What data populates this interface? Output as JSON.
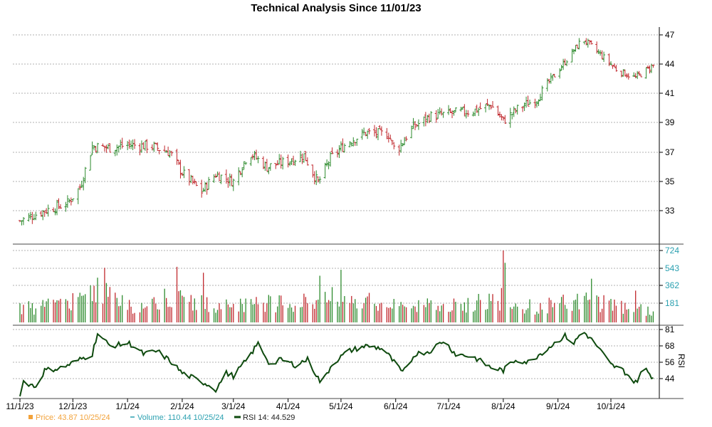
{
  "chart_data": {
    "type": "ohlc",
    "title": "Technical Analysis Since 11/01/23",
    "x_ticks": [
      "11/1/23",
      "12/1/23",
      "1/1/24",
      "2/1/24",
      "3/1/24",
      "4/1/24",
      "5/1/24",
      "6/1/24",
      "7/1/24",
      "8/1/24",
      "9/1/24",
      "10/1/24"
    ],
    "price_axis": {
      "ticks": [
        "33",
        "35",
        "37",
        "39",
        "41",
        "44",
        "47"
      ],
      "ylim": [
        31.5,
        47.6
      ]
    },
    "volume_axis": {
      "ticks": [
        "181",
        "362",
        "543",
        "724"
      ],
      "ylim": [
        0,
        724
      ]
    },
    "rsi_axis": {
      "label": "RSI",
      "ticks": [
        "44",
        "56",
        "68",
        "81"
      ],
      "ylim": [
        30,
        81
      ]
    },
    "colors": {
      "up": "#2e8b2e",
      "down": "#c0282d",
      "rsi": "#0e4a0e",
      "volume_label": "#2aa0b0",
      "price_label": "#f2a23a",
      "grid": "#b0b0b0"
    },
    "price_anchors": [
      {
        "date": "11/1/23",
        "close": 32.3
      },
      {
        "date": "11/15/23",
        "close": 33.0
      },
      {
        "date": "11/28/23",
        "close": 33.5
      },
      {
        "date": "12/5/23",
        "close": 34.6
      },
      {
        "date": "12/12/23",
        "close": 37.4
      },
      {
        "date": "12/22/23",
        "close": 37.3
      },
      {
        "date": "1/2/24",
        "close": 37.5
      },
      {
        "date": "1/15/24",
        "close": 37.4
      },
      {
        "date": "1/25/24",
        "close": 37.0
      },
      {
        "date": "2/1/24",
        "close": 35.6
      },
      {
        "date": "2/12/24",
        "close": 34.3
      },
      {
        "date": "2/20/24",
        "close": 35.5
      },
      {
        "date": "3/1/24",
        "close": 35.0
      },
      {
        "date": "3/10/24",
        "close": 37.0
      },
      {
        "date": "3/20/24",
        "close": 36.0
      },
      {
        "date": "4/1/24",
        "close": 36.4
      },
      {
        "date": "4/10/24",
        "close": 36.8
      },
      {
        "date": "4/18/24",
        "close": 34.9
      },
      {
        "date": "4/25/24",
        "close": 36.6
      },
      {
        "date": "5/5/24",
        "close": 37.7
      },
      {
        "date": "5/15/24",
        "close": 38.3
      },
      {
        "date": "5/28/24",
        "close": 38.2
      },
      {
        "date": "6/1/24",
        "close": 37.0
      },
      {
        "date": "6/10/24",
        "close": 38.6
      },
      {
        "date": "6/20/24",
        "close": 39.4
      },
      {
        "date": "7/1/24",
        "close": 39.6
      },
      {
        "date": "7/15/24",
        "close": 39.8
      },
      {
        "date": "7/25/24",
        "close": 40.2
      },
      {
        "date": "8/1/24",
        "close": 39.1
      },
      {
        "date": "8/10/24",
        "close": 40.0
      },
      {
        "date": "8/20/24",
        "close": 40.6
      },
      {
        "date": "9/1/24",
        "close": 43.3
      },
      {
        "date": "9/10/24",
        "close": 45.4
      },
      {
        "date": "9/15/24",
        "close": 46.6
      },
      {
        "date": "9/25/24",
        "close": 45.0
      },
      {
        "date": "10/5/24",
        "close": 43.3
      },
      {
        "date": "10/15/24",
        "close": 42.6
      },
      {
        "date": "10/25/24",
        "close": 43.87
      }
    ],
    "volume_anchors": [
      {
        "date": "11/1/23",
        "value": 150
      },
      {
        "date": "12/1/23",
        "value": 220
      },
      {
        "date": "12/15/23",
        "value": 380
      },
      {
        "date": "1/1/24",
        "value": 180
      },
      {
        "date": "1/20/24",
        "value": 260
      },
      {
        "date": "2/1/24",
        "value": 240
      },
      {
        "date": "2/15/24",
        "value": 220
      },
      {
        "date": "3/1/24",
        "value": 210
      },
      {
        "date": "3/15/24",
        "value": 240
      },
      {
        "date": "4/1/24",
        "value": 200
      },
      {
        "date": "4/20/24",
        "value": 260
      },
      {
        "date": "5/1/24",
        "value": 270
      },
      {
        "date": "6/1/24",
        "value": 180
      },
      {
        "date": "7/1/24",
        "value": 180
      },
      {
        "date": "8/1/24",
        "value": 260
      },
      {
        "date": "8/20/24",
        "value": 160
      },
      {
        "date": "9/1/24",
        "value": 210
      },
      {
        "date": "9/20/24",
        "value": 250
      },
      {
        "date": "10/10/24",
        "value": 170
      },
      {
        "date": "10/25/24",
        "value": 110.44
      }
    ],
    "volume_spikes": [
      {
        "date": "12/19/23",
        "value": 550
      },
      {
        "date": "1/29/24",
        "value": 560
      },
      {
        "date": "2/13/24",
        "value": 500
      },
      {
        "date": "4/19/24",
        "value": 470
      },
      {
        "date": "5/1/24",
        "value": 530
      },
      {
        "date": "8/1/24",
        "value": 724
      },
      {
        "date": "8/2/24",
        "value": 600
      },
      {
        "date": "9/20/24",
        "value": 440
      },
      {
        "date": "10/15/24",
        "value": 320
      }
    ],
    "rsi_anchors": [
      {
        "date": "11/1/23",
        "value": 31
      },
      {
        "date": "11/3/23",
        "value": 42
      },
      {
        "date": "11/10/23",
        "value": 38
      },
      {
        "date": "11/15/23",
        "value": 50
      },
      {
        "date": "11/25/23",
        "value": 52
      },
      {
        "date": "12/5/23",
        "value": 58
      },
      {
        "date": "12/12/23",
        "value": 62
      },
      {
        "date": "12/15/23",
        "value": 78
      },
      {
        "date": "12/22/23",
        "value": 68
      },
      {
        "date": "1/2/24",
        "value": 70
      },
      {
        "date": "1/10/24",
        "value": 62
      },
      {
        "date": "1/18/24",
        "value": 64
      },
      {
        "date": "1/26/24",
        "value": 56
      },
      {
        "date": "2/1/24",
        "value": 48
      },
      {
        "date": "2/8/24",
        "value": 44
      },
      {
        "date": "2/15/24",
        "value": 40
      },
      {
        "date": "2/20/24",
        "value": 36
      },
      {
        "date": "2/26/24",
        "value": 48
      },
      {
        "date": "3/1/24",
        "value": 46
      },
      {
        "date": "3/10/24",
        "value": 60
      },
      {
        "date": "3/15/24",
        "value": 70
      },
      {
        "date": "3/22/24",
        "value": 54
      },
      {
        "date": "3/28/24",
        "value": 58
      },
      {
        "date": "4/5/24",
        "value": 54
      },
      {
        "date": "4/12/24",
        "value": 58
      },
      {
        "date": "4/20/24",
        "value": 40
      },
      {
        "date": "4/26/24",
        "value": 55
      },
      {
        "date": "5/5/24",
        "value": 64
      },
      {
        "date": "5/15/24",
        "value": 68
      },
      {
        "date": "5/25/24",
        "value": 66
      },
      {
        "date": "5/31/24",
        "value": 56
      },
      {
        "date": "6/5/24",
        "value": 48
      },
      {
        "date": "6/12/24",
        "value": 62
      },
      {
        "date": "6/20/24",
        "value": 64
      },
      {
        "date": "6/28/24",
        "value": 72
      },
      {
        "date": "7/5/24",
        "value": 62
      },
      {
        "date": "7/15/24",
        "value": 60
      },
      {
        "date": "7/25/24",
        "value": 52
      },
      {
        "date": "8/1/24",
        "value": 50
      },
      {
        "date": "8/8/24",
        "value": 58
      },
      {
        "date": "8/15/24",
        "value": 56
      },
      {
        "date": "8/25/24",
        "value": 65
      },
      {
        "date": "9/5/24",
        "value": 76
      },
      {
        "date": "9/10/24",
        "value": 70
      },
      {
        "date": "9/15/24",
        "value": 80
      },
      {
        "date": "9/22/24",
        "value": 70
      },
      {
        "date": "10/1/24",
        "value": 54
      },
      {
        "date": "10/8/24",
        "value": 50
      },
      {
        "date": "10/15/24",
        "value": 41
      },
      {
        "date": "10/20/24",
        "value": 52
      },
      {
        "date": "10/25/24",
        "value": 44.529
      }
    ],
    "legend": [
      {
        "label": "Price: 43.87  10/25/24",
        "color": "#f2a23a",
        "marker": "square"
      },
      {
        "label": "Volume: 110.44  10/25/24",
        "color": "#2aa0b0",
        "marker": "dash"
      },
      {
        "label": "RSI 14: 44.529",
        "color": "#0e4a0e",
        "marker": "line"
      }
    ]
  }
}
